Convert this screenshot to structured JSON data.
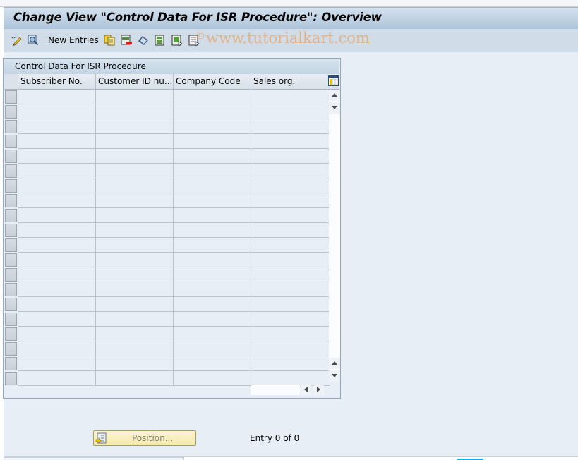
{
  "window": {
    "title": "Change View \"Control Data For ISR Procedure\": Overview"
  },
  "toolbar": {
    "items": [
      {
        "icon": "edit-display-toggle-icon",
        "tooltip": ""
      },
      {
        "icon": "find-icon",
        "tooltip": ""
      },
      {
        "label": "New Entries"
      },
      {
        "icon": "copy-as-icon"
      },
      {
        "icon": "delete-icon"
      },
      {
        "icon": "undo-change-icon"
      },
      {
        "icon": "select-all-icon"
      },
      {
        "icon": "select-block-icon"
      },
      {
        "icon": "deselect-all-icon"
      }
    ],
    "new_entries_label": "New Entries",
    "watermark": "www.tutorialkart.com",
    "watermark_symbol": "©"
  },
  "table": {
    "caption": "Control Data For ISR Procedure",
    "columns": [
      {
        "key": "subscriber_no",
        "label": "Subscriber No."
      },
      {
        "key": "customer_id",
        "label": "Customer ID nu..."
      },
      {
        "key": "company_code",
        "label": "Company Code"
      },
      {
        "key": "sales_org",
        "label": "Sales org."
      }
    ],
    "rows": [
      [
        "",
        "",
        "",
        ""
      ],
      [
        "",
        "",
        "",
        ""
      ],
      [
        "",
        "",
        "",
        ""
      ],
      [
        "",
        "",
        "",
        ""
      ],
      [
        "",
        "",
        "",
        ""
      ],
      [
        "",
        "",
        "",
        ""
      ],
      [
        "",
        "",
        "",
        ""
      ],
      [
        "",
        "",
        "",
        ""
      ],
      [
        "",
        "",
        "",
        ""
      ],
      [
        "",
        "",
        "",
        ""
      ],
      [
        "",
        "",
        "",
        ""
      ],
      [
        "",
        "",
        "",
        ""
      ],
      [
        "",
        "",
        "",
        ""
      ],
      [
        "",
        "",
        "",
        ""
      ],
      [
        "",
        "",
        "",
        ""
      ],
      [
        "",
        "",
        "",
        ""
      ],
      [
        "",
        "",
        "",
        ""
      ],
      [
        "",
        "",
        "",
        ""
      ],
      [
        "",
        "",
        "",
        ""
      ],
      [
        "",
        "",
        "",
        ""
      ]
    ],
    "config_icon": "table-settings-icon"
  },
  "footer": {
    "position_button_label": "Position...",
    "entry_info": "Entry 0 of 0"
  },
  "colors": {
    "title_bar": "#adc4da",
    "toolbar": "#d0dce7",
    "background": "#e8eef5",
    "position_button": "#f6eaa9",
    "watermark": "#e8a66a",
    "accent": "#1fa7e0"
  }
}
